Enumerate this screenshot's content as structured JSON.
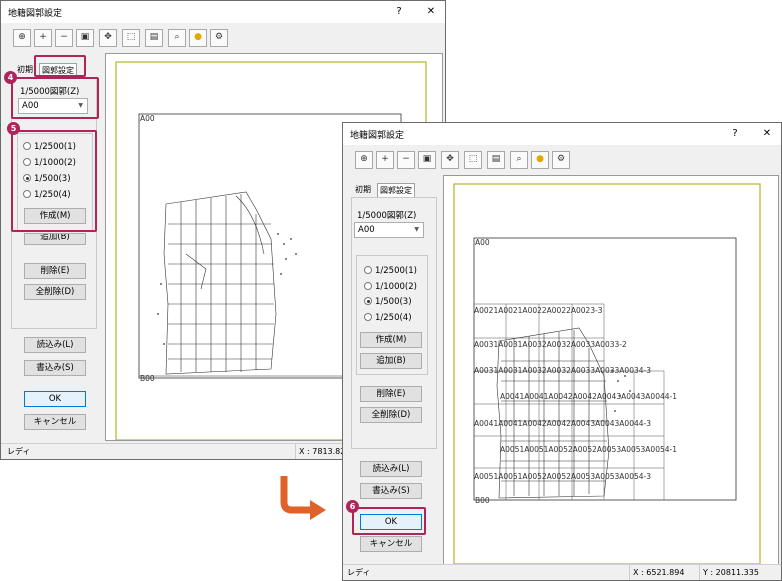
{
  "window_left": {
    "title": "地籍図郭設定",
    "help": "?",
    "close": "✕",
    "tabs": [
      "初期",
      "図郭設定"
    ],
    "scale_label": "1/5000図郭(Z)",
    "combo_value": "A00",
    "radios": [
      "1/2500(1)",
      "1/1000(2)",
      "1/500(3)",
      "1/250(4)"
    ],
    "selected_radio": 2,
    "create": "作成(M)",
    "add": "追加(B)",
    "delete": "削除(E)",
    "delete_all": "全削除(D)",
    "load": "読込み(L)",
    "save": "書込み(S)",
    "ok": "OK",
    "cancel": "キャンセル",
    "status_ready": "レディ",
    "status_x": "X : 7813.820",
    "map_labels": [
      "A00",
      "B00"
    ]
  },
  "window_right": {
    "title": "地籍図郭設定",
    "help": "?",
    "close": "✕",
    "tabs": [
      "初期",
      "図郭設定"
    ],
    "scale_label": "1/5000図郭(Z)",
    "combo_value": "A00",
    "radios": [
      "1/2500(1)",
      "1/1000(2)",
      "1/500(3)",
      "1/250(4)"
    ],
    "selected_radio": 2,
    "create": "作成(M)",
    "add": "追加(B)",
    "delete": "削除(E)",
    "delete_all": "全削除(D)",
    "load": "読込み(L)",
    "save": "書込み(S)",
    "ok": "OK",
    "cancel": "キャンセル",
    "status_ready": "レディ",
    "status_x": "X : 6521.894",
    "status_y": "Y : 20811.335",
    "map_labels": [
      "A00",
      "B00"
    ],
    "grid_rows": [
      "A0021A0021A0022A0022A0023-3",
      "A0031A0031A0032A0032A0033A0033-2",
      "A0031A0031A0032A0032A0033A0033A0034-3",
      "A0041A0041A0042A0042A0043A0043A0044-1",
      "A0041A0041A0042A0042A0043A0043A0044-3",
      "A0051A0051A0052A0052A0053A0053A0054-1",
      "A0051A0051A0052A0052A0053A0053A0054-3"
    ]
  },
  "badges": [
    "4",
    "5",
    "6"
  ],
  "colors": {
    "highlight": "#b0245a",
    "arrow": "#e0622a",
    "frame": "#b5b52a"
  }
}
